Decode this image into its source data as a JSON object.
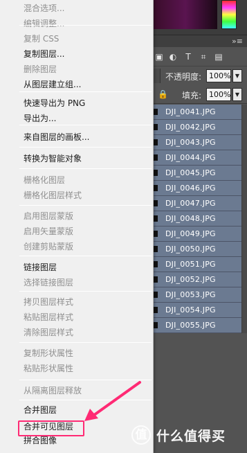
{
  "context_menu": {
    "items": [
      {
        "label": "混合选项...",
        "enabled": false
      },
      {
        "label": "编辑调整...",
        "enabled": false
      },
      {
        "label": "复制 CSS",
        "enabled": false
      },
      {
        "label": "复制图层...",
        "enabled": true
      },
      {
        "label": "删除图层",
        "enabled": false
      },
      {
        "label": "从图层建立组...",
        "enabled": true
      },
      {
        "label": "快速导出为 PNG",
        "enabled": true
      },
      {
        "label": "导出为...",
        "enabled": true
      },
      {
        "label": "来自图层的画板...",
        "enabled": true
      },
      {
        "label": "转换为智能对象",
        "enabled": true
      },
      {
        "label": "栅格化图层",
        "enabled": false
      },
      {
        "label": "栅格化图层样式",
        "enabled": false
      },
      {
        "label": "启用图层蒙版",
        "enabled": false
      },
      {
        "label": "启用矢量蒙版",
        "enabled": false
      },
      {
        "label": "创建剪贴蒙版",
        "enabled": false
      },
      {
        "label": "链接图层",
        "enabled": true
      },
      {
        "label": "选择链接图层",
        "enabled": false
      },
      {
        "label": "拷贝图层样式",
        "enabled": false
      },
      {
        "label": "粘贴图层样式",
        "enabled": false
      },
      {
        "label": "清除图层样式",
        "enabled": false
      },
      {
        "label": "复制形状属性",
        "enabled": false
      },
      {
        "label": "粘贴形状属性",
        "enabled": false
      },
      {
        "label": "从隔离图层释放",
        "enabled": false
      },
      {
        "label": "合并图层",
        "enabled": true
      },
      {
        "label": "合并可见图层",
        "enabled": true,
        "highlighted": true
      },
      {
        "label": "拼合图像",
        "enabled": true
      }
    ]
  },
  "layers_panel": {
    "opacity_label": "不透明度:",
    "opacity_value": "100%",
    "fill_label": "填充:",
    "fill_value": "100%",
    "layers": [
      "DJI_0041.JPG",
      "DJI_0042.JPG",
      "DJI_0043.JPG",
      "DJI_0044.JPG",
      "DJI_0045.JPG",
      "DJI_0046.JPG",
      "DJI_0047.JPG",
      "DJI_0048.JPG",
      "DJI_0049.JPG",
      "DJI_0050.JPG",
      "DJI_0051.JPG",
      "DJI_0052.JPG",
      "DJI_0053.JPG",
      "DJI_0054.JPG",
      "DJI_0055.JPG"
    ],
    "filter_icons": [
      "image-filter-icon",
      "adjustment-filter-icon",
      "type-filter-icon",
      "shape-filter-icon",
      "smart-object-filter-icon"
    ]
  },
  "annotation": {
    "highlight_color": "#ff2a74"
  },
  "watermark": {
    "text": "什么值得买",
    "logo": "值"
  }
}
